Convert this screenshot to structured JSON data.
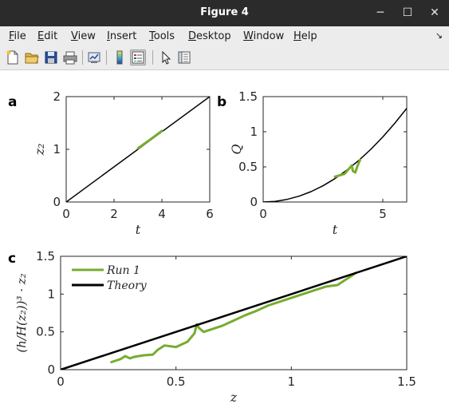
{
  "window": {
    "title": "Figure 4",
    "minimize_icon": "minimize-icon",
    "maximize_icon": "maximize-icon",
    "close_icon": "close-icon",
    "minimize_glyph": "─",
    "maximize_glyph": "☐",
    "close_glyph": "✕"
  },
  "menu": {
    "items": [
      {
        "label": "File",
        "mnemonic": "F",
        "rest": "ile"
      },
      {
        "label": "Edit",
        "mnemonic": "E",
        "rest": "dit"
      },
      {
        "label": "View",
        "mnemonic": "V",
        "rest": "iew"
      },
      {
        "label": "Insert",
        "mnemonic": "I",
        "rest": "nsert"
      },
      {
        "label": "Tools",
        "mnemonic": "T",
        "rest": "ools"
      },
      {
        "label": "Desktop",
        "mnemonic": "D",
        "rest": "esktop"
      },
      {
        "label": "Window",
        "mnemonic": "W",
        "rest": "indow"
      },
      {
        "label": "Help",
        "mnemonic": "H",
        "rest": "elp"
      }
    ],
    "overflow_glyph": "↘"
  },
  "toolbar": {
    "buttons": [
      {
        "icon": "new-figure-icon"
      },
      {
        "icon": "open-file-icon"
      },
      {
        "icon": "save-icon"
      },
      {
        "icon": "print-icon"
      },
      {
        "icon": "link-plot-icon"
      },
      {
        "icon": "colorbar-icon"
      },
      {
        "icon": "legend-icon",
        "selected": true
      },
      {
        "icon": "pointer-icon"
      },
      {
        "icon": "property-inspector-icon"
      }
    ]
  },
  "colors": {
    "theory": "#000000",
    "run": "#77ac30",
    "axes": "#262626"
  },
  "chart_data": [
    {
      "panel": "a",
      "type": "line",
      "xlabel": "t",
      "ylabel": "z₂",
      "xlim": [
        0,
        6
      ],
      "ylim": [
        0,
        2
      ],
      "xticks": [
        "0",
        "2",
        "4",
        "6"
      ],
      "yticks": [
        "0",
        "1",
        "2"
      ],
      "series": [
        {
          "kind": "theory",
          "x": [
            0,
            6
          ],
          "y": [
            0,
            2
          ]
        },
        {
          "kind": "run",
          "x": [
            3.0,
            3.5,
            4.0
          ],
          "y": [
            1.02,
            1.18,
            1.35
          ]
        }
      ]
    },
    {
      "panel": "b",
      "type": "line",
      "xlabel": "t",
      "ylabel": "Q",
      "xlim": [
        0,
        6
      ],
      "ylim": [
        0,
        1.5
      ],
      "xticks": [
        "0",
        "5"
      ],
      "yticks": [
        "0",
        "0.5",
        "1",
        "1.5"
      ],
      "series": [
        {
          "kind": "theory",
          "x": [
            0,
            0.5,
            1,
            1.5,
            2,
            2.5,
            3,
            3.5,
            4,
            4.5,
            5,
            5.5,
            6
          ],
          "y": [
            0,
            0.009,
            0.037,
            0.083,
            0.148,
            0.231,
            0.333,
            0.454,
            0.593,
            0.75,
            0.926,
            1.12,
            1.333
          ]
        },
        {
          "kind": "run",
          "x": [
            3.0,
            3.2,
            3.4,
            3.5,
            3.6,
            3.7,
            3.75,
            3.85,
            3.95,
            4.05
          ],
          "y": [
            0.36,
            0.38,
            0.4,
            0.44,
            0.48,
            0.52,
            0.44,
            0.42,
            0.52,
            0.6
          ]
        }
      ]
    },
    {
      "panel": "c",
      "type": "line",
      "xlabel": "z",
      "ylabel": "(h/H(z₂))³ · z₂",
      "xlim": [
        0,
        1.5
      ],
      "ylim": [
        0,
        1.5
      ],
      "xticks": [
        "0",
        "0.5",
        "1",
        "1.5"
      ],
      "yticks": [
        "0",
        "0.5",
        "1",
        "1.5"
      ],
      "legend": {
        "position": "top-left",
        "entries": [
          "Run 1",
          "Theory"
        ]
      },
      "series": [
        {
          "name": "Run 1",
          "kind": "run",
          "x": [
            0.22,
            0.26,
            0.28,
            0.3,
            0.32,
            0.36,
            0.4,
            0.42,
            0.45,
            0.5,
            0.55,
            0.58,
            0.59,
            0.6,
            0.62,
            0.65,
            0.7,
            0.75,
            0.8,
            0.85,
            0.9,
            0.95,
            1.0,
            1.05,
            1.1,
            1.15,
            1.2,
            1.23,
            1.25,
            1.28
          ],
          "y": [
            0.1,
            0.14,
            0.18,
            0.15,
            0.17,
            0.19,
            0.2,
            0.26,
            0.32,
            0.3,
            0.37,
            0.48,
            0.6,
            0.55,
            0.5,
            0.53,
            0.58,
            0.65,
            0.72,
            0.78,
            0.85,
            0.9,
            0.95,
            1.0,
            1.05,
            1.1,
            1.12,
            1.18,
            1.22,
            1.28
          ]
        },
        {
          "name": "Theory",
          "kind": "theory",
          "x": [
            0,
            1.5
          ],
          "y": [
            0,
            1.5
          ]
        }
      ]
    }
  ]
}
